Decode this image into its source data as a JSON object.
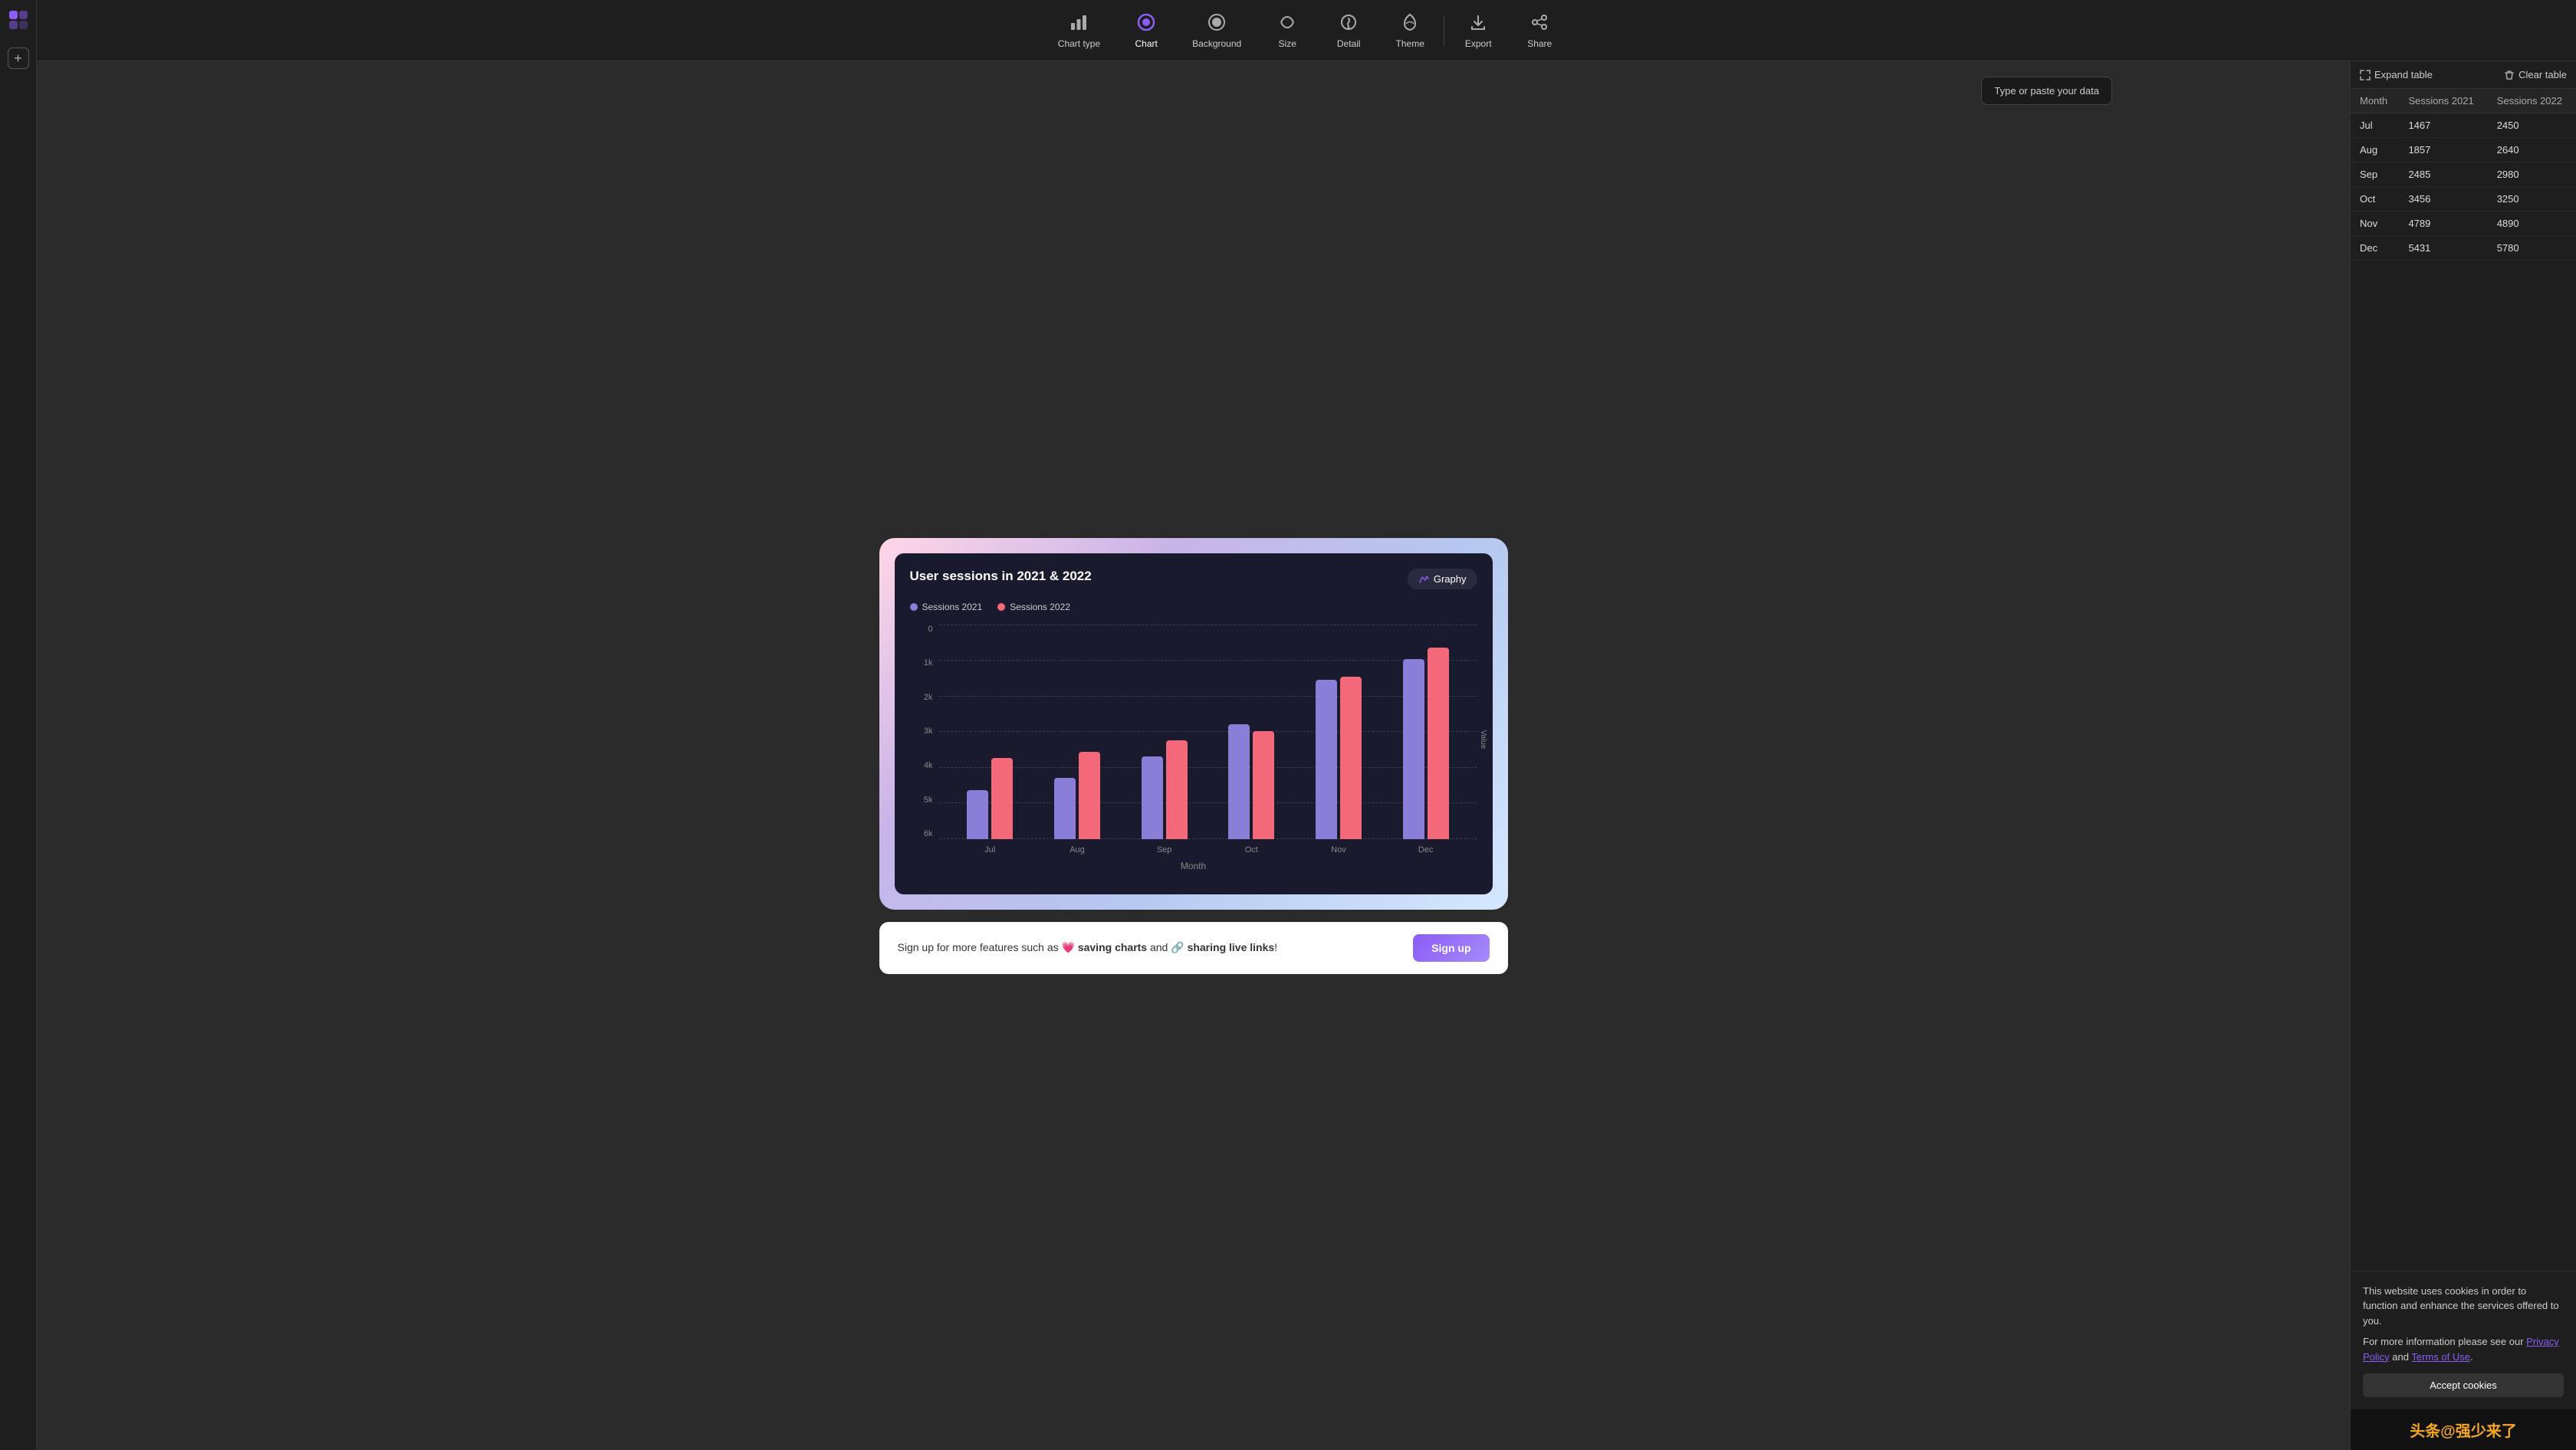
{
  "app": {
    "logo_symbol": "◈",
    "add_label": "+"
  },
  "toolbar": {
    "items": [
      {
        "id": "chart-type",
        "label": "Chart type",
        "icon": "chart-type"
      },
      {
        "id": "chart",
        "label": "Chart",
        "icon": "chart",
        "active": true
      },
      {
        "id": "background",
        "label": "Background",
        "icon": "background"
      },
      {
        "id": "size",
        "label": "Size",
        "icon": "size"
      },
      {
        "id": "detail",
        "label": "Detail",
        "icon": "detail"
      },
      {
        "id": "theme",
        "label": "Theme",
        "icon": "theme"
      },
      {
        "id": "export",
        "label": "Export",
        "icon": "export"
      },
      {
        "id": "share",
        "label": "Share",
        "icon": "share"
      }
    ]
  },
  "chart": {
    "title": "User sessions in 2021 & 2022",
    "badge_text": "Graphy",
    "legend": [
      {
        "label": "Sessions 2021",
        "color": "blue"
      },
      {
        "label": "Sessions 2022",
        "color": "pink"
      }
    ],
    "x_axis_label": "Month",
    "y_axis_label": "Value",
    "y_labels": [
      "0",
      "1k",
      "2k",
      "3k",
      "4k",
      "5k",
      "6k"
    ],
    "bars": [
      {
        "month": "Jul",
        "v2021": 1467,
        "v2022": 2450
      },
      {
        "month": "Aug",
        "v2021": 1857,
        "v2022": 2640
      },
      {
        "month": "Sep",
        "v2021": 2485,
        "v2022": 2980
      },
      {
        "month": "Oct",
        "v2021": 3456,
        "v2022": 3250
      },
      {
        "month": "Nov",
        "v2021": 4789,
        "v2022": 4890
      },
      {
        "month": "Dec",
        "v2021": 5431,
        "v2022": 5780
      }
    ],
    "max_value": 6000
  },
  "signup_banner": {
    "text_prefix": "Sign up for more features such as",
    "heart": "💗",
    "bold1": "saving charts",
    "text_mid": "and",
    "link_icon": "🔗",
    "bold2": "sharing live links",
    "text_suffix": "!",
    "button_label": "Sign up"
  },
  "data_hint": {
    "placeholder": "Type or paste your data"
  },
  "table": {
    "expand_label": "Expand table",
    "clear_label": "Clear table",
    "columns": [
      "Month",
      "Sessions 2021",
      "Sessions 2022"
    ],
    "rows": [
      [
        "Jul",
        "1467",
        "2450"
      ],
      [
        "Aug",
        "1857",
        "2640"
      ],
      [
        "Sep",
        "2485",
        "2980"
      ],
      [
        "Oct",
        "3456",
        "3250"
      ],
      [
        "Nov",
        "4789",
        "4890"
      ],
      [
        "Dec",
        "5431",
        "5780"
      ]
    ]
  },
  "cookie": {
    "text1": "This website uses cookies in order to function and enhance the services offered to you.",
    "text2": "For more information please see our ",
    "privacy_label": "Privacy Policy",
    "text3": " and ",
    "terms_label": "Terms of Use",
    "text4": ".",
    "accept_label": "Accept cookies"
  },
  "watermark": {
    "text": "头条@强少来了"
  }
}
